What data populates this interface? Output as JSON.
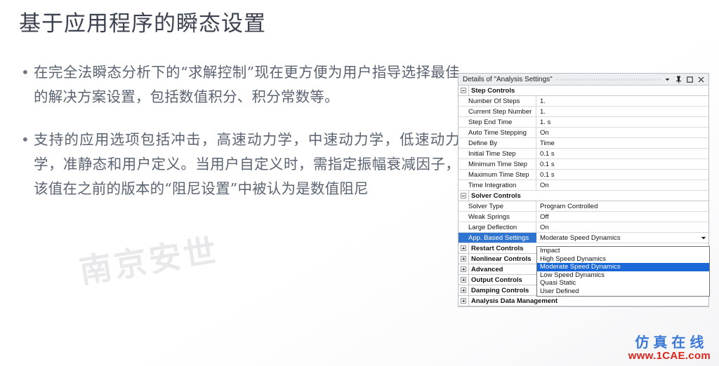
{
  "slide": {
    "title": "基于应用程序的瞬态设置",
    "title_color": "#3c4250",
    "bullet_marker": "•",
    "bullets": [
      "在完全法瞬态分析下的“求解控制”现在更方便为用户指导选择最佳的解决方案设置，包括数值积分、积分常数等。",
      "支持的应用选项包括冲击，高速动力学，中速动力学，低速动力学，准静态和用户定义。当用户自定义时，需指定振幅衰减因子，该值在之前的版本的“阻尼设置”中被认为是数值阻尼"
    ],
    "watermark": "南京安世"
  },
  "logo": {
    "brand_cn": "仿真在线",
    "brand_cn_color": "#3b79d4",
    "url": "www.1CAE.com",
    "url_color": "#d8261c"
  },
  "details_panel": {
    "title": "Details of \"Analysis Settings\"",
    "titlebar_icons": [
      {
        "name": "chevron-down-icon",
        "glyph": "▾"
      },
      {
        "name": "pin-icon",
        "glyph": "⚲"
      },
      {
        "name": "restore-icon",
        "glyph": "▢"
      },
      {
        "name": "close-icon",
        "glyph": "✕"
      }
    ],
    "selection_color": "#2f74d0",
    "sections": [
      {
        "label": "Step Controls",
        "expanded": true,
        "rows": [
          {
            "name": "Number Of Steps",
            "value": "1."
          },
          {
            "name": "Current Step Number",
            "value": "1."
          },
          {
            "name": "Step End Time",
            "value": "1. s"
          },
          {
            "name": "Auto Time Stepping",
            "value": "On"
          },
          {
            "name": "Define By",
            "value": "Time"
          },
          {
            "name": "Initial Time Step",
            "value": "0.1 s"
          },
          {
            "name": "Minimum Time Step",
            "value": "0.1 s"
          },
          {
            "name": "Maximum Time Step",
            "value": "0.1 s"
          },
          {
            "name": "Time Integration",
            "value": "On"
          }
        ]
      },
      {
        "label": "Solver Controls",
        "expanded": true,
        "rows": [
          {
            "name": "Solver Type",
            "value": "Program Controlled"
          },
          {
            "name": "Weak Springs",
            "value": "Off"
          },
          {
            "name": "Large Deflection",
            "value": "On"
          },
          {
            "name": "App. Based Settings",
            "value": "Moderate Speed Dynamics",
            "selected": true,
            "combo": true
          }
        ]
      }
    ],
    "collapsed_sections": [
      {
        "label": "Restart Controls"
      },
      {
        "label": "Nonlinear Controls"
      },
      {
        "label": "Advanced"
      },
      {
        "label": "Output Controls"
      },
      {
        "label": "Damping Controls"
      },
      {
        "label": "Analysis Data Management"
      }
    ],
    "dropdown": {
      "open": true,
      "selected": "Moderate Speed Dynamics",
      "options": [
        "Impact",
        "High Speed Dynamics",
        "Moderate Speed Dynamics",
        "Low Speed Dynamics",
        "Quasi Static",
        "User Defined"
      ]
    }
  }
}
